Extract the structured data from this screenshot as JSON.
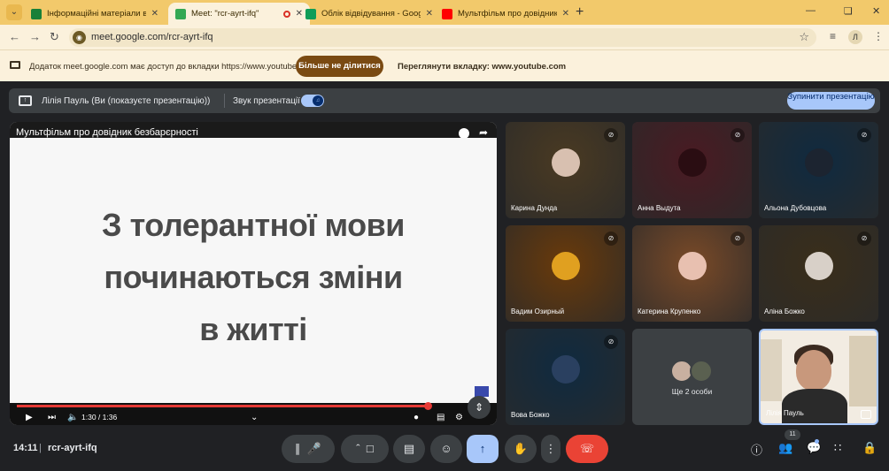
{
  "browser": {
    "tabs": [
      {
        "label": "Інформаційні матеріали в рамк",
        "color": "#188038",
        "active": false
      },
      {
        "label": "Meet: \"rcr-ayrt-ifq\"",
        "color": "#34a853",
        "active": true,
        "recording": true
      },
      {
        "label": "Облік відвідування - Google Т",
        "color": "#0f9d58",
        "active": false
      },
      {
        "label": "Мультфільм про довідник",
        "color": "#ff0000",
        "active": false
      }
    ],
    "url": "meet.google.com/rcr-ayrt-ifq",
    "profile_initial": "Л"
  },
  "banner": {
    "message": "Додаток meet.google.com має доступ до вкладки https://www.youtube.com",
    "stop_sharing": "Більше не ділитися",
    "view_tab": "Переглянути вкладку: www.youtube.com"
  },
  "presenting": {
    "label": "Лілія Пауль (Ви (показуєте презентацію))",
    "audio_label": "Звук презентації",
    "audio_on": true,
    "stop_label": "Зупинити презентацію"
  },
  "video": {
    "title": "Мультфільм про довідник безбарєрності",
    "slide_lines": [
      "З толерантної мови",
      "починаються зміни",
      "в житті"
    ],
    "time": "1:30 / 1:36",
    "progress": 0.91
  },
  "participants": [
    {
      "name": "Карина Дунда",
      "muted": true,
      "bg": "#4a3a22",
      "face": "#d8c0b0"
    },
    {
      "name": "Анна Выдута",
      "muted": true,
      "bg": "#4a1a22",
      "face": "#2a0d12"
    },
    {
      "name": "Альона Дубовцова",
      "muted": true,
      "bg": "#0f2a40",
      "face": "#1c2430"
    },
    {
      "name": "Вадим Озирный",
      "muted": true,
      "bg": "#6a3a0a",
      "face": "#e0a020"
    },
    {
      "name": "Катерина Крупенко",
      "muted": true,
      "bg": "#7a4a28",
      "face": "#e8c0b0"
    },
    {
      "name": "Аліна Божко",
      "muted": true,
      "bg": "#3a2e1a",
      "face": "#d8d0c8"
    },
    {
      "name": "Вова Божко",
      "muted": true,
      "bg": "#0f2a40",
      "face": "#2a4060"
    }
  ],
  "more": {
    "label": "Ще 2 особи",
    "faces": [
      "#c8b0a0",
      "#5a6050"
    ]
  },
  "self": {
    "name": "Лілія Пауль"
  },
  "bottombar": {
    "clock": "14:11",
    "separator": "|",
    "meeting_code": "rcr-ayrt-ifq",
    "people_count": "11"
  }
}
